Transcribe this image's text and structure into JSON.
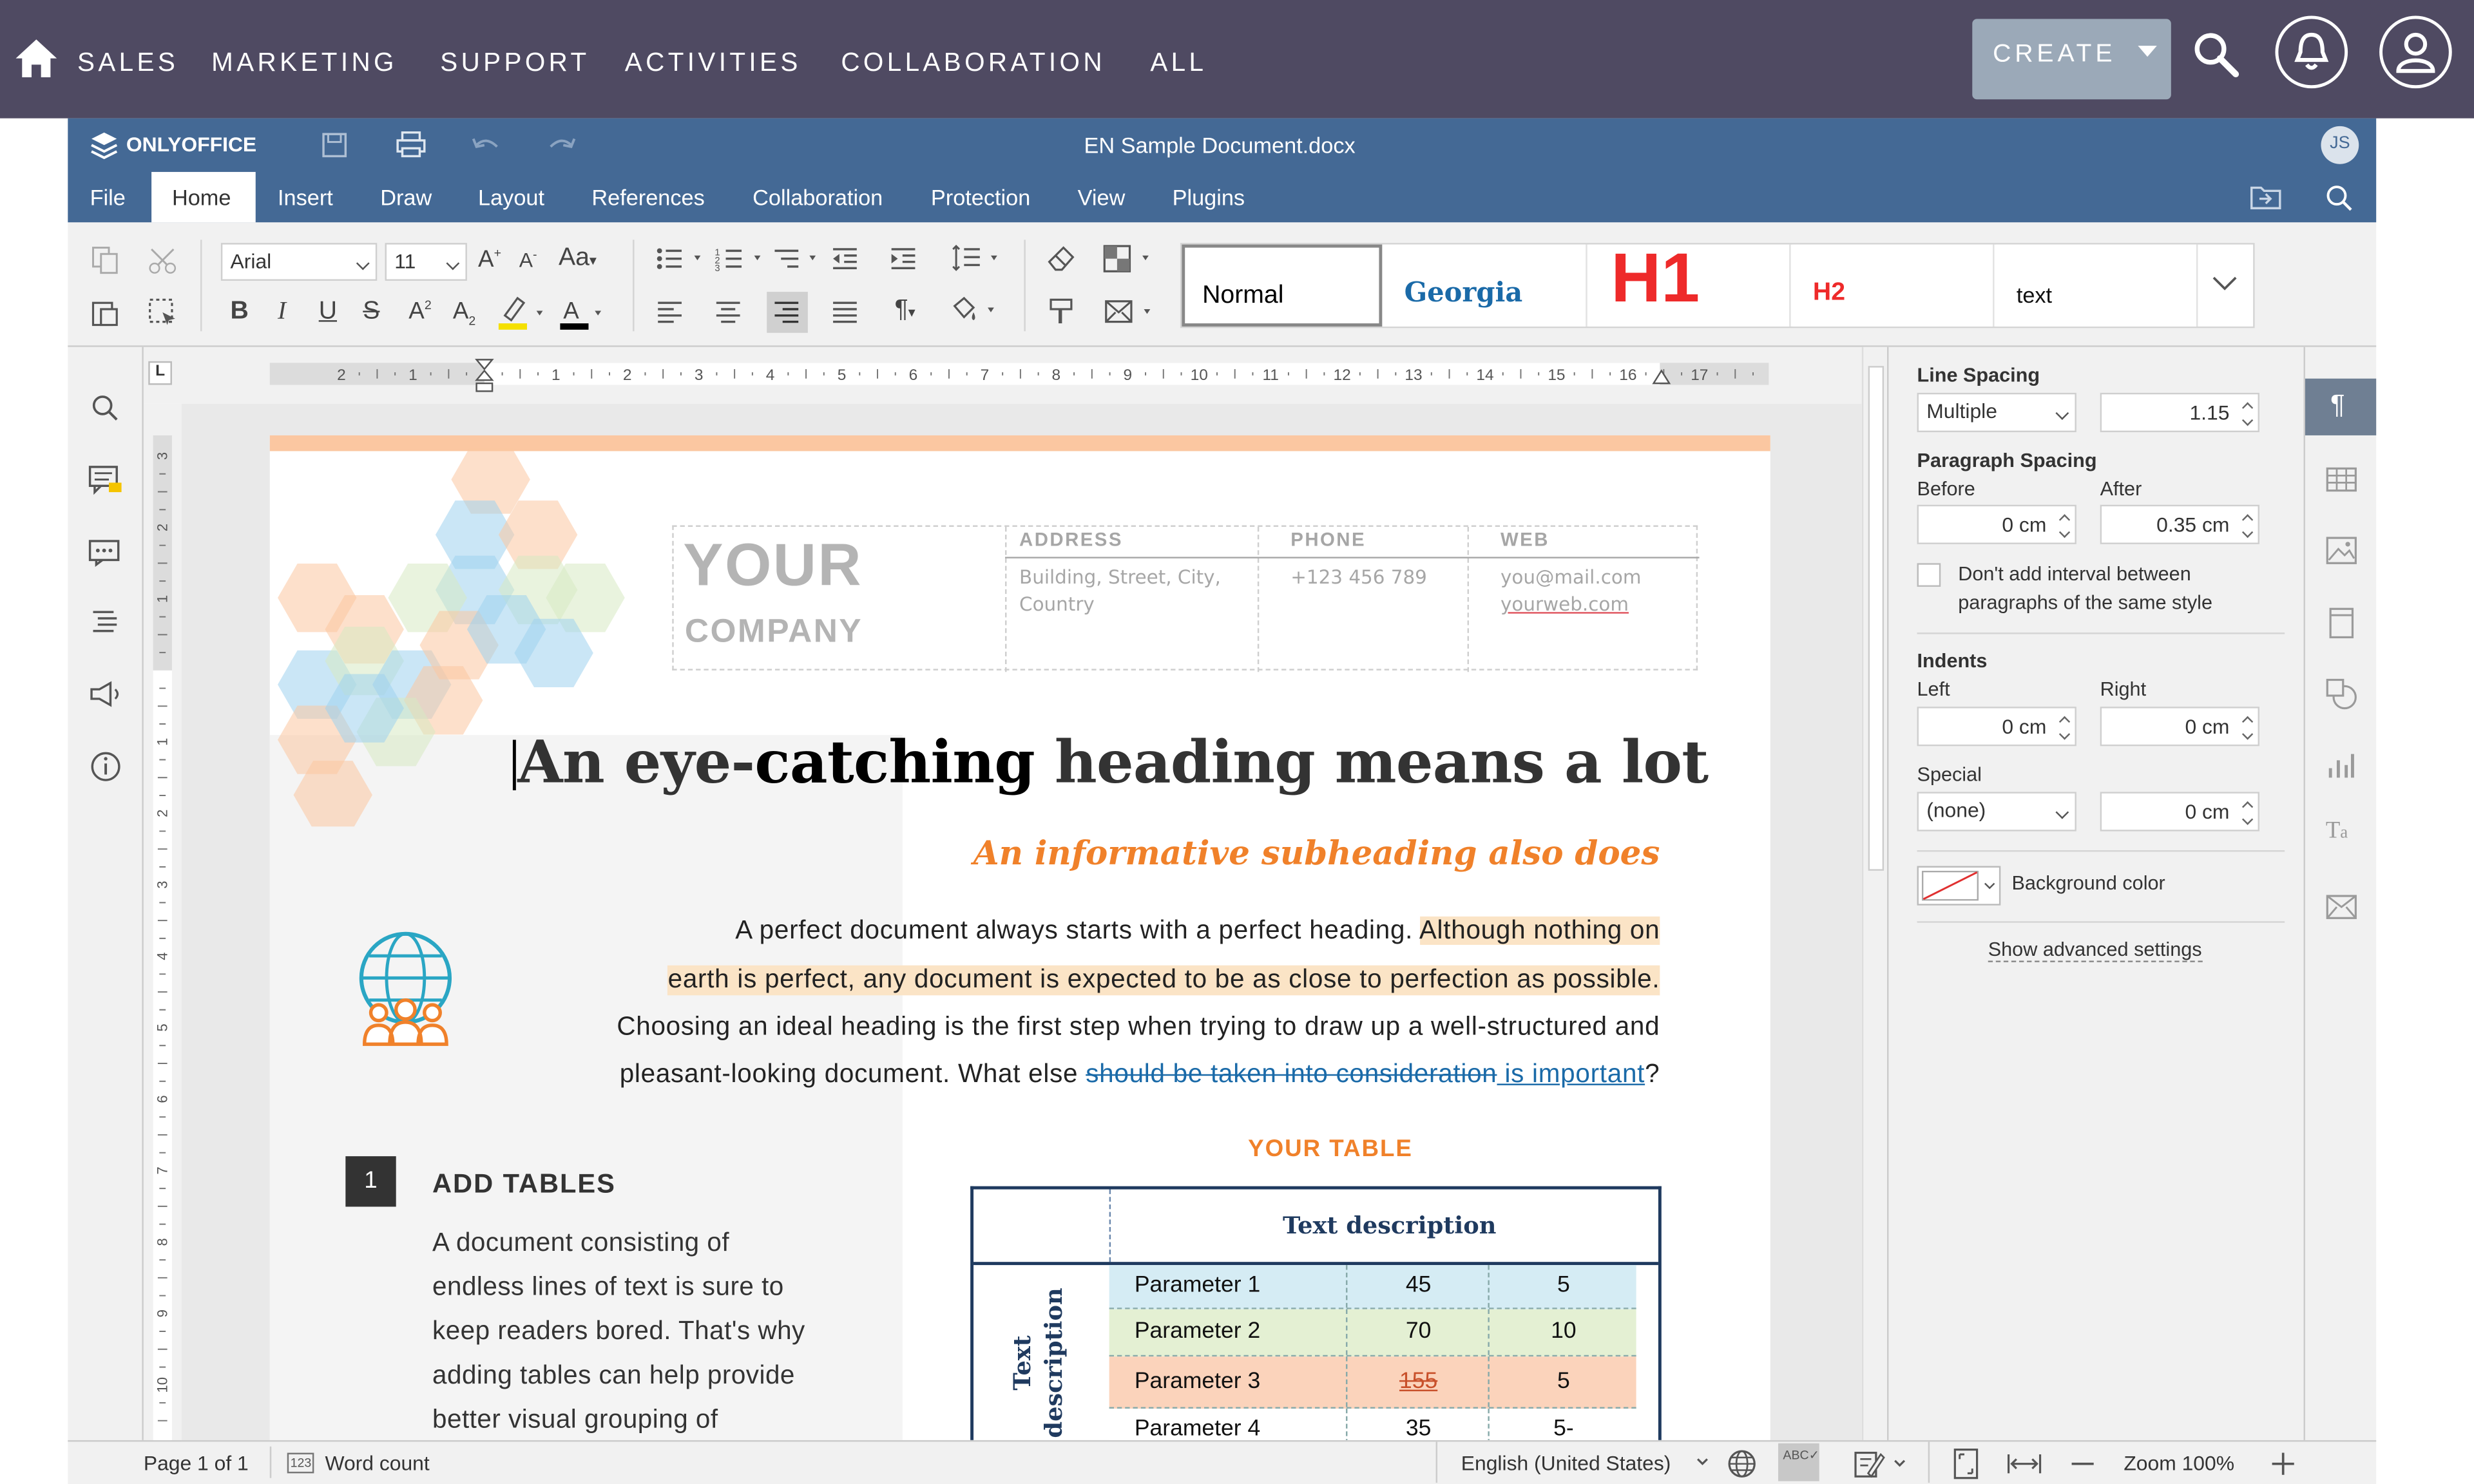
{
  "crm": {
    "nav": [
      "SALES",
      "MARKETING",
      "SUPPORT",
      "ACTIVITIES",
      "COLLABORATION",
      "ALL"
    ],
    "create_label": "CREATE"
  },
  "editor": {
    "brand": "ONLYOFFICE",
    "doc_title": "EN Sample Document.docx",
    "user_initials": "JS",
    "tabs": [
      "File",
      "Home",
      "Insert",
      "Draw",
      "Layout",
      "References",
      "Collaboration",
      "Protection",
      "View",
      "Plugins"
    ],
    "active_tab": "Home"
  },
  "toolbar": {
    "font_name": "Arial",
    "font_size": "11",
    "styles": [
      "Normal",
      "Georgia",
      "H1",
      "H2",
      "text"
    ],
    "highlight_color": "#f5e000",
    "font_color": "#000000"
  },
  "document": {
    "company_line1": "YOUR",
    "company_line2": "COMPANY",
    "contact_headers": [
      "ADDRESS",
      "PHONE",
      "WEB"
    ],
    "address_lines": [
      "Building, Street, City,",
      "Country"
    ],
    "phone": "+123 456 789",
    "web_email": "you@mail.com",
    "web_site": "yourweb.com",
    "heading_part1": "An eye-",
    "heading_part2": "catching",
    "heading_part3": " heading means a lot",
    "subheading": "An informative subheading also does",
    "para_line1_a": "A perfect document always starts with a perfect heading. ",
    "para_line1_b": "Although nothing on",
    "para_line2": "earth is perfect, any document is expected to be as close to perfection as possible.",
    "para_line3": "Choosing an ideal heading is the first step when trying to draw up a well-structured and",
    "para_line4_a": "pleasant-looking document. What else ",
    "para_line4_del": "should be taken into consideration",
    "para_line4_ins": " is important",
    "para_line4_end": "?",
    "section_number": "1",
    "section_title": "ADD TABLES",
    "section_lines": [
      "A document consisting of",
      "endless lines of text is sure to",
      "keep readers bored. That's why",
      "adding tables can help provide",
      "better visual grouping of"
    ],
    "table_title": "YOUR TABLE",
    "table_header": "Text description",
    "table_side": "Text description",
    "table_rows": [
      {
        "label": "Parameter 1",
        "v1": "45",
        "v2": "5",
        "color": "#d5ecf4"
      },
      {
        "label": "Parameter 2",
        "v1": "70",
        "v2": "10",
        "color": "#e4f0d3"
      },
      {
        "label": "Parameter 3",
        "v1": "155",
        "v2": "5",
        "color": "#fbd3bb"
      },
      {
        "label": "Parameter 4",
        "v1": "35",
        "v2": "5-",
        "color": "#ffffff"
      }
    ],
    "accent_orange": "#f0812a",
    "accent_blue": "#1a6aa8"
  },
  "panel": {
    "line_spacing_label": "Line Spacing",
    "line_spacing_mode": "Multiple",
    "line_spacing_value": "1.15",
    "paragraph_spacing_label": "Paragraph Spacing",
    "before_label": "Before",
    "before_value": "0 cm",
    "after_label": "After",
    "after_value": "0.35 cm",
    "no_interval_label_1": "Don't add interval between",
    "no_interval_label_2": "paragraphs of the same style",
    "indents_label": "Indents",
    "left_label": "Left",
    "left_value": "0 cm",
    "right_label": "Right",
    "right_value": "0 cm",
    "special_label": "Special",
    "special_mode": "(none)",
    "special_value": "0 cm",
    "background_color_label": "Background color",
    "advanced_settings": "Show advanced settings"
  },
  "status": {
    "page": "Page 1 of 1",
    "word_count": "Word count",
    "language": "English (United States)",
    "zoom": "Zoom 100%"
  }
}
